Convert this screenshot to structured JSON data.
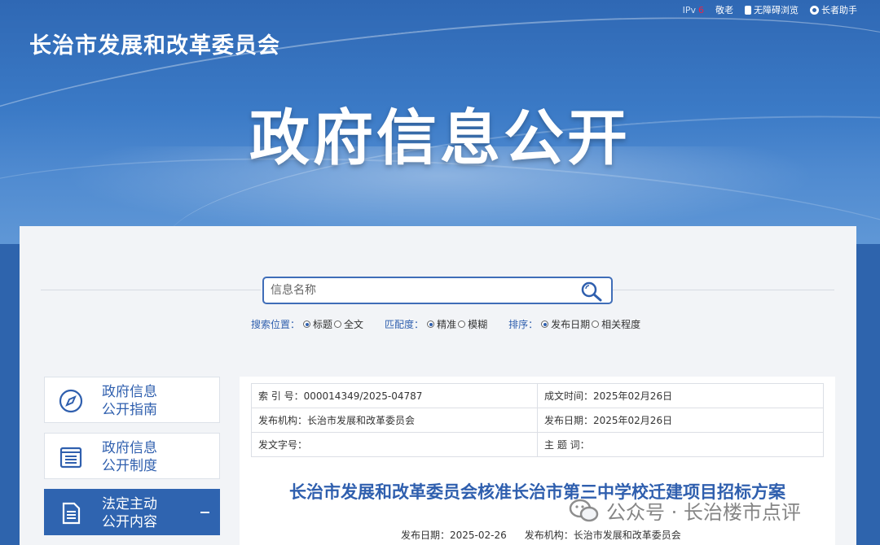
{
  "header": {
    "site_name": "长治市发展和改革委员会",
    "banner_title": "政府信息公开",
    "links": {
      "ipv6_prefix": "IPv",
      "ipv6_suffix": "6",
      "elder": "敬老",
      "accessible": "无障碍浏览",
      "helper": "长者助手"
    }
  },
  "search": {
    "placeholder": "信息名称",
    "scope_label": "搜索位置：",
    "scope_options": [
      "标题",
      "全文"
    ],
    "match_label": "匹配度：",
    "match_options": [
      "精准",
      "模糊"
    ],
    "sort_label": "排序：",
    "sort_options": [
      "发布日期",
      "相关程度"
    ]
  },
  "sidenav": {
    "items": [
      {
        "line1": "政府信息",
        "line2": "公开指南",
        "icon": "compass-icon"
      },
      {
        "line1": "政府信息",
        "line2": "公开制度",
        "icon": "list-icon"
      },
      {
        "line1": "法定主动",
        "line2": "公开内容",
        "icon": "document-icon",
        "active": true
      }
    ]
  },
  "doc": {
    "index_no": "索  引 号：000014349/2025-04787",
    "created": "成文时间：2025年02月26日",
    "publisher": "发布机构：长治市发展和改革委员会",
    "publish_date": "发布日期：2025年02月26日",
    "doc_no": "发文字号：",
    "subject": "主  题  词：",
    "title": "长治市发展和改革委员会核准长治市第三中学校迁建项目招标方案",
    "meta_date": "发布日期：2025-02-26",
    "meta_org": "发布机构：长治市发展和改革委员会"
  },
  "watermark": {
    "text": "公众号 · 长治楼市点评"
  },
  "colors": {
    "brand_blue": "#2f64b0",
    "link_blue": "#2f5fae"
  }
}
